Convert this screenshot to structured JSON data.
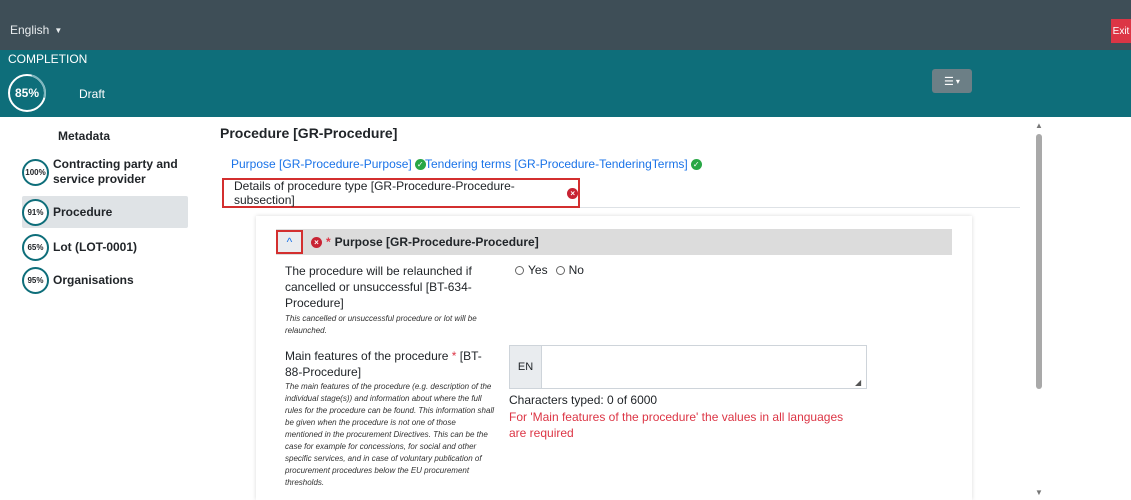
{
  "topbar": {
    "language": "English",
    "exit_label": "Exit"
  },
  "status": {
    "completion_label": "COMPLETION",
    "completion_pct": "85%",
    "state": "Draft"
  },
  "sidebar": {
    "title": "Metadata",
    "items": [
      {
        "pct": "100%",
        "label": "Contracting party and service provider",
        "active": false
      },
      {
        "pct": "91%",
        "label": "Procedure",
        "active": true
      },
      {
        "pct": "65%",
        "label": "Lot (LOT-0001)",
        "active": false
      },
      {
        "pct": "95%",
        "label": "Organisations",
        "active": false
      }
    ]
  },
  "main": {
    "title": "Procedure [GR-Procedure]",
    "tabs": [
      {
        "label": "Purpose  [GR-Procedure-Purpose]",
        "status": "ok"
      },
      {
        "label": "Tendering terms  [GR-Procedure-TenderingTerms]",
        "status": "ok"
      },
      {
        "label": "Details of procedure type  [GR-Procedure-Procedure-subsection]",
        "status": "error"
      }
    ],
    "panel": {
      "header": "Purpose  [GR-Procedure-Procedure]",
      "fields": {
        "relaunch": {
          "label": "The procedure will be relaunched if cancelled or unsuccessful [BT-634-Procedure]",
          "help": "This cancelled or unsuccessful procedure or lot will be relaunched.",
          "options": [
            "Yes",
            "No"
          ]
        },
        "main_features": {
          "label_prefix": "Main features of the procedure ",
          "label_required": "*",
          "label_suffix": " [BT-88-Procedure]",
          "help": "The main features of the procedure (e.g. description of the individual stage(s)) and information about where the full rules for the procedure can be found. This information shall be given when the procedure is not one of those mentioned in the procurement Directives. This can be the case for example for concessions, for social and other specific services, and in case of voluntary publication of procurement procedures below the EU procurement thresholds.",
          "lang_prefix": "EN",
          "chars": "Characters typed: 0 of 6000",
          "error": "For 'Main features of the procedure' the values in all languages are required"
        }
      }
    }
  },
  "colors": {
    "topbar": "#3e4e57",
    "teal": "#0e6e7a",
    "link": "#1a73e8",
    "error": "#dc3545",
    "ok": "#28a745"
  }
}
